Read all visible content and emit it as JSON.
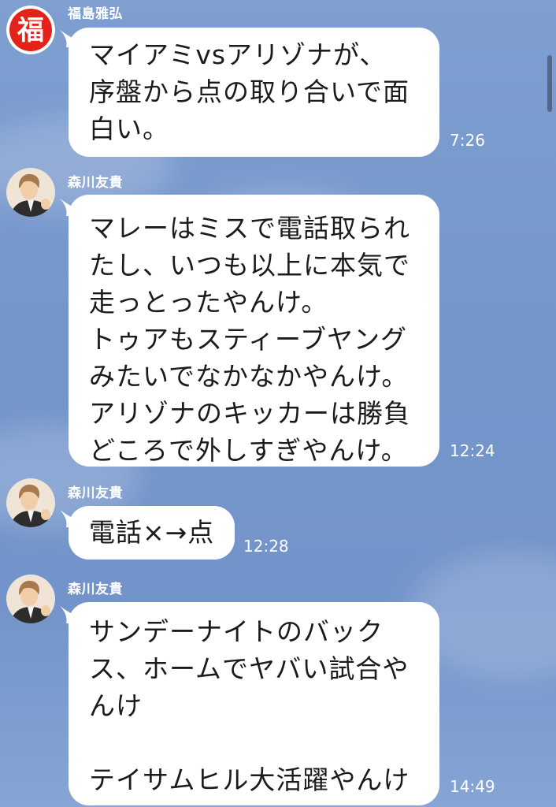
{
  "colors": {
    "background": "#7596cb",
    "bubble": "#ffffff",
    "text": "#1b1b1b",
    "meta_text": "#ffffff",
    "fuku_badge_red": "#e2231a"
  },
  "messages": [
    {
      "sender": "福島雅弘",
      "avatar_icon": "fuku-badge-icon",
      "avatar_char": "福",
      "lines": [
        "マイアミvsアリゾナが、",
        "序盤から点の取り合いで面",
        "白い。"
      ],
      "time": "7:26"
    },
    {
      "sender": "森川友貴",
      "avatar_icon": "person-avatar-icon",
      "lines": [
        "マレーはミスで電話取られ",
        "たし、いつも以上に本気で",
        "走っとったやんけ。",
        "トゥアもスティーブヤング",
        "みたいでなかなかやんけ。",
        "アリゾナのキッカーは勝負",
        "どころで外しすぎやんけ。"
      ],
      "time": "12:24"
    },
    {
      "sender": "森川友貴",
      "avatar_icon": "person-avatar-icon",
      "lines": [
        "電話×→点"
      ],
      "time": "12:28"
    },
    {
      "sender": "森川友貴",
      "avatar_icon": "person-avatar-icon",
      "lines": [
        "サンデーナイトのバック",
        "ス、ホームでヤバい試合や",
        "んけ",
        "",
        "テイサムヒル大活躍やんけ"
      ],
      "time": "14:49"
    }
  ]
}
